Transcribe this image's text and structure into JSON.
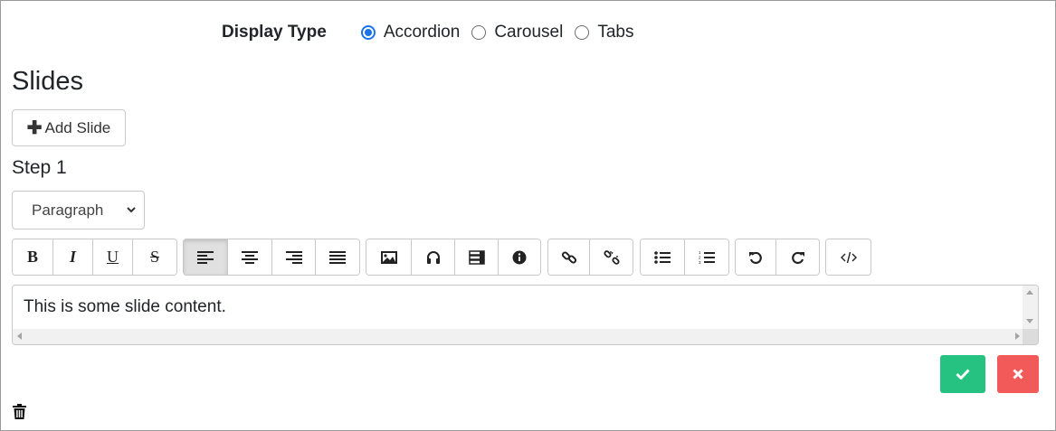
{
  "display_type": {
    "label": "Display Type",
    "options": [
      {
        "label": "Accordion",
        "selected": true
      },
      {
        "label": "Carousel",
        "selected": false
      },
      {
        "label": "Tabs",
        "selected": false
      }
    ]
  },
  "slides": {
    "title": "Slides",
    "add_button_label": "Add Slide"
  },
  "step": {
    "title": "Step 1",
    "format_select_value": "Paragraph",
    "toolbar": {
      "bold_label": "B",
      "italic_label": "I",
      "underline_label": "U",
      "strike_label": "S",
      "active_alignment": "align-left"
    },
    "editor_content": "This is some slide content."
  },
  "colors": {
    "accent": "#1a73e8",
    "save": "#26c281",
    "cancel": "#f25a5a"
  },
  "icons": [
    "plus-icon",
    "chevron-down-icon",
    "align-left-icon",
    "align-center-icon",
    "align-right-icon",
    "align-justify-icon",
    "image-icon",
    "audio-icon",
    "table-icon",
    "info-icon",
    "link-icon",
    "unlink-icon",
    "bullet-list-icon",
    "numbered-list-icon",
    "undo-icon",
    "redo-icon",
    "code-icon",
    "check-icon",
    "close-icon",
    "trash-icon"
  ]
}
